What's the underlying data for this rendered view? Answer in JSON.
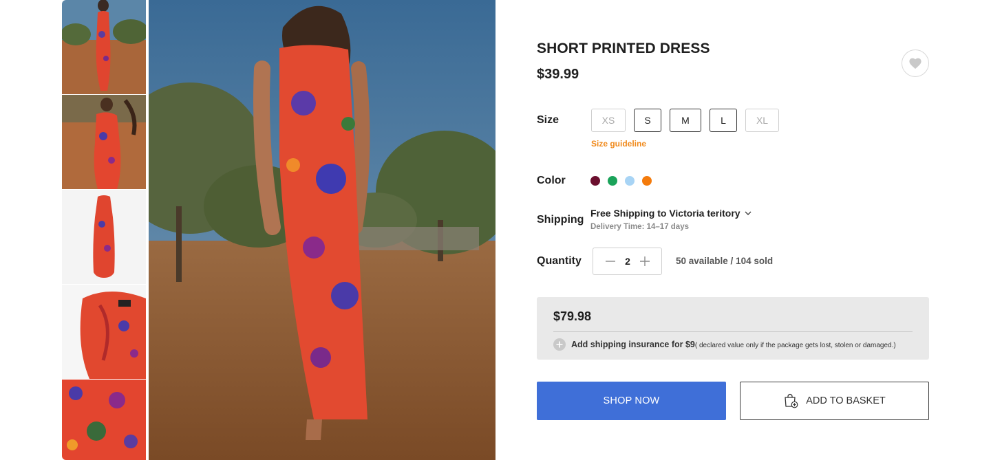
{
  "product": {
    "title": "SHORT PRINTED DRESS",
    "price": "$39.99",
    "wishlist_icon": "heart-icon"
  },
  "gallery": {
    "thumbnails": [
      "dress-back-view",
      "dress-front-model",
      "dress-flat-lay",
      "dress-neckline-detail",
      "print-detail"
    ],
    "main_image": "dress-back-view"
  },
  "size": {
    "label": "Size",
    "options": [
      {
        "label": "XS",
        "available": false
      },
      {
        "label": "S",
        "available": true
      },
      {
        "label": "M",
        "available": true
      },
      {
        "label": "L",
        "available": true
      },
      {
        "label": "XL",
        "available": false
      }
    ],
    "guideline": "Size guideline"
  },
  "color": {
    "label": "Color",
    "swatches": [
      "#6b0f2e",
      "#1aa35a",
      "#a8d4f5",
      "#f47b0c"
    ]
  },
  "shipping": {
    "label": "Shipping",
    "option": "Free Shipping to Victoria teritory",
    "delivery": "Delivery Time: 14–17 days"
  },
  "quantity": {
    "label": "Quantity",
    "value": "2",
    "stock": "50 available / 104 sold"
  },
  "summary": {
    "total": "$79.98",
    "insurance": "Add shipping insurance for $9",
    "insurance_note": "( declared value  only if the package gets lost, stolen or damaged.)"
  },
  "actions": {
    "shop_now": "SHOP NOW",
    "add_to_basket": "ADD TO BASKET"
  },
  "colors": {
    "primary_button": "#3f6fd8",
    "accent": "#f08a1c"
  }
}
